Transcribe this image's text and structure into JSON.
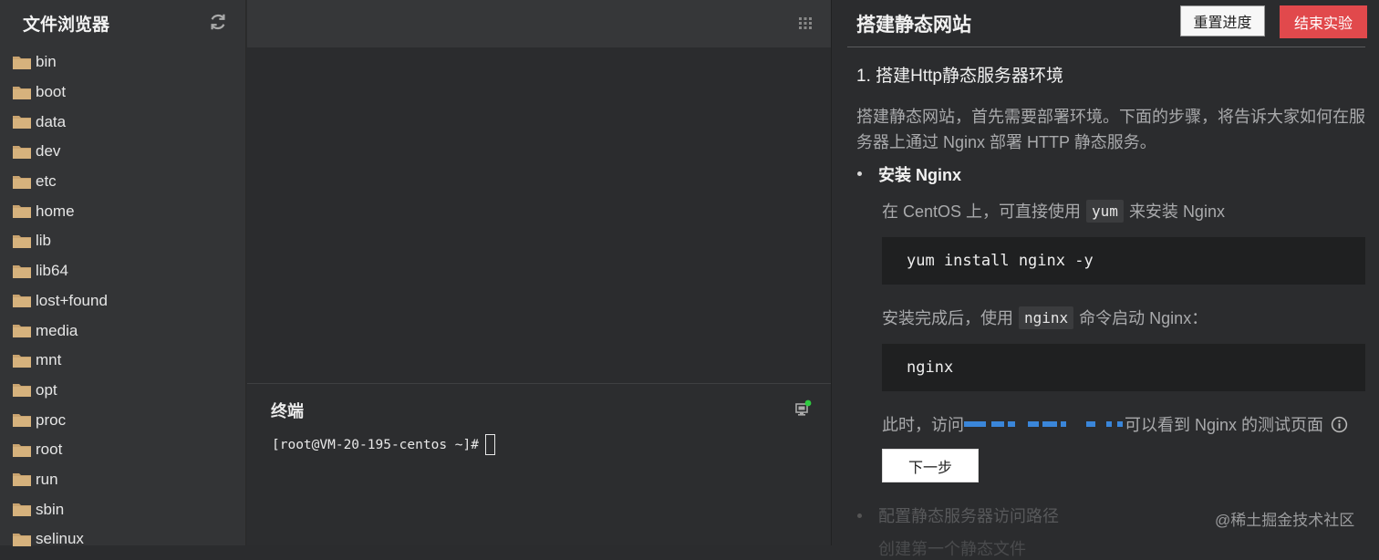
{
  "sidebar": {
    "title": "文件浏览器",
    "items": [
      "bin",
      "boot",
      "data",
      "dev",
      "etc",
      "home",
      "lib",
      "lib64",
      "lost+found",
      "media",
      "mnt",
      "opt",
      "proc",
      "root",
      "run",
      "sbin",
      "selinux"
    ]
  },
  "terminal": {
    "title": "终端",
    "prompt": "[root@VM-20-195-centos ~]#"
  },
  "tutorial": {
    "title": "搭建静态网站",
    "reset_label": "重置进度",
    "end_label": "结束实验",
    "step_heading": "1. 搭建Http静态服务器环境",
    "intro": "搭建静态网站，首先需要部署环境。下面的步骤，将告诉大家如何在服务器上通过 Nginx 部署 HTTP 静态服务。",
    "bullet_1": "安装 Nginx",
    "line_1_before": "在 CentOS 上，可直接使用",
    "line_1_code": "yum",
    "line_1_after": "来安装 Nginx",
    "code_1": "yum install nginx -y",
    "line_2_before": "安装完成后，使用",
    "line_2_code": "nginx",
    "line_2_after": "命令启动 Nginx：",
    "code_2": "nginx",
    "line_3_before": "此时，访问",
    "line_3_after": "可以看到 Nginx 的测试页面",
    "next_label": "下一步",
    "bullet_2": "配置静态服务器访问路径",
    "bullet_3": "创建第一个静态文件",
    "watermark": "@稀土掘金技术社区"
  },
  "colors": {
    "accent_red": "#e1494c",
    "status_green": "#2ecc40",
    "link_blue": "#3a86d9"
  }
}
